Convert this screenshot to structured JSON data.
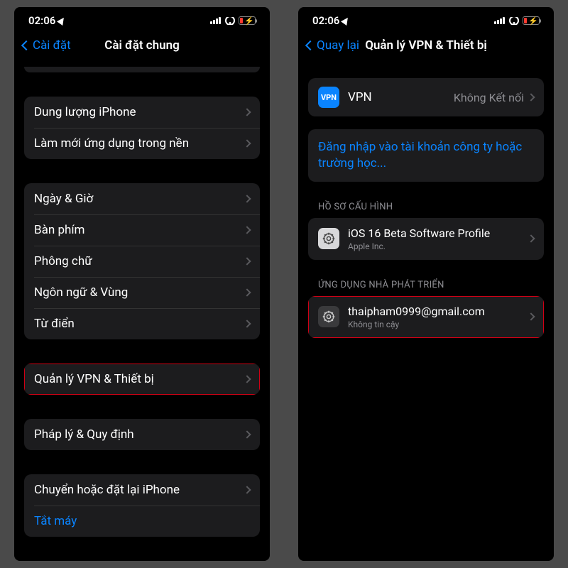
{
  "status": {
    "time": "02:06"
  },
  "left_screen": {
    "back": "Cài đặt",
    "title": "Cài đặt chung",
    "group1": [
      "Dung lượng iPhone",
      "Làm mới ứng dụng trong nền"
    ],
    "group2": [
      "Ngày & Giờ",
      "Bàn phím",
      "Phông chữ",
      "Ngôn ngữ & Vùng",
      "Từ điển"
    ],
    "group3": [
      "Quản lý VPN & Thiết bị"
    ],
    "group4": [
      "Pháp lý & Quy định"
    ],
    "group5": [
      "Chuyển hoặc đặt lại iPhone",
      "Tắt máy"
    ]
  },
  "right_screen": {
    "back": "Quay lại",
    "title": "Quản lý VPN & Thiết bị",
    "vpn": {
      "icon_label": "VPN",
      "label": "VPN",
      "status": "Không Kết nối"
    },
    "signin": "Đăng nhập vào tài khoản công ty hoặc trường học...",
    "profile_header": "HỒ SƠ CẤU HÌNH",
    "profile": {
      "name": "iOS 16 Beta Software Profile",
      "publisher": "Apple Inc."
    },
    "dev_header": "ỨNG DỤNG NHÀ PHÁT TRIỂN",
    "dev": {
      "email": "thaipham0999@gmail.com",
      "status": "Không tin cậy"
    }
  }
}
